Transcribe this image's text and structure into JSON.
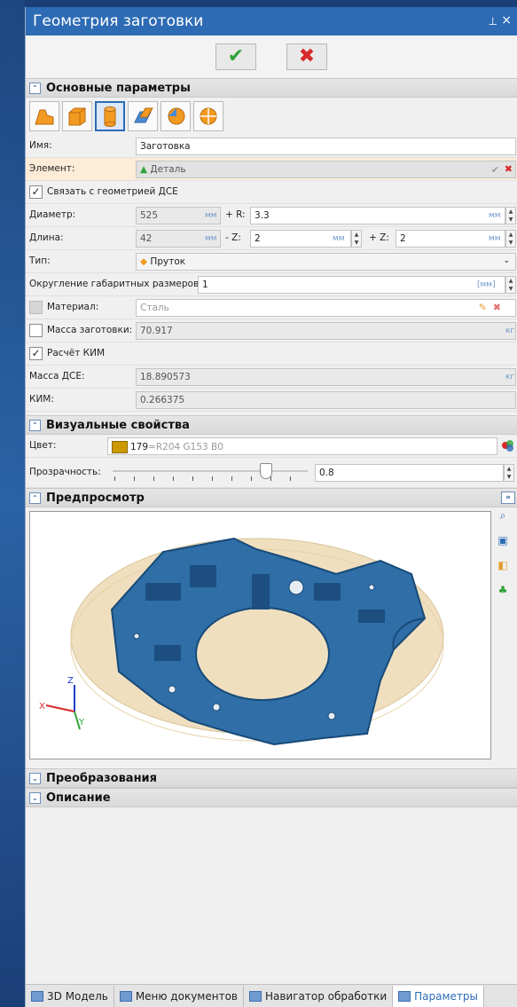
{
  "window": {
    "title": "Геометрия заготовки",
    "pin_glyph": "⊥",
    "close_glyph": "×"
  },
  "actions": {
    "ok_glyph": "✔",
    "cancel_glyph": "✖"
  },
  "sections": {
    "main": "Основные параметры",
    "visual": "Визуальные свойства",
    "preview": "Предпросмотр",
    "transform": "Преобразования",
    "description": "Описание"
  },
  "toggle_up": "⌃",
  "toggle_down": "⌄",
  "main": {
    "name_label": "Имя:",
    "name_value": "Заготовка",
    "element_label": "Элемент:",
    "element_value": "Деталь",
    "link_geometry_label": "Связать с геометрией ДСЕ",
    "diameter_label": "Диаметр:",
    "diameter_value": "525",
    "unit_mm": "мм",
    "r_label": "+ R:",
    "r_value": "3.3",
    "length_label": "Длина:",
    "length_value": "42",
    "minus_z_label": "- Z:",
    "minus_z_value": "2",
    "plus_z_label": "+ Z:",
    "plus_z_value": "2",
    "type_label": "Тип:",
    "type_value": "Пруток",
    "rounding_label": "Округление габаритных размеров:",
    "rounding_value": "1",
    "rounding_unit": "[мм]",
    "material_label": "Материал:",
    "material_value": "Сталь",
    "blank_mass_label": "Масса заготовки:",
    "blank_mass_value": "70.917",
    "unit_kg": "кг",
    "calc_kim_label": "Расчёт КИМ",
    "part_mass_label": "Масса ДСЕ:",
    "part_mass_value": "18.890573",
    "kim_label": "КИМ:",
    "kim_value": "0.266375"
  },
  "visual": {
    "color_label": "Цвет:",
    "color_index": "179",
    "color_desc": "=R204 G153 B0",
    "color_hex": "#cc9900",
    "transparency_label": "Прозрачность:",
    "transparency_value": "0.8",
    "transparency_fraction": 0.8
  },
  "preview_axes": {
    "x": "X",
    "y": "Y",
    "z": "Z"
  },
  "tabs": [
    "3D Модель",
    "Меню документов",
    "Навигатор обработки",
    "Параметры"
  ]
}
